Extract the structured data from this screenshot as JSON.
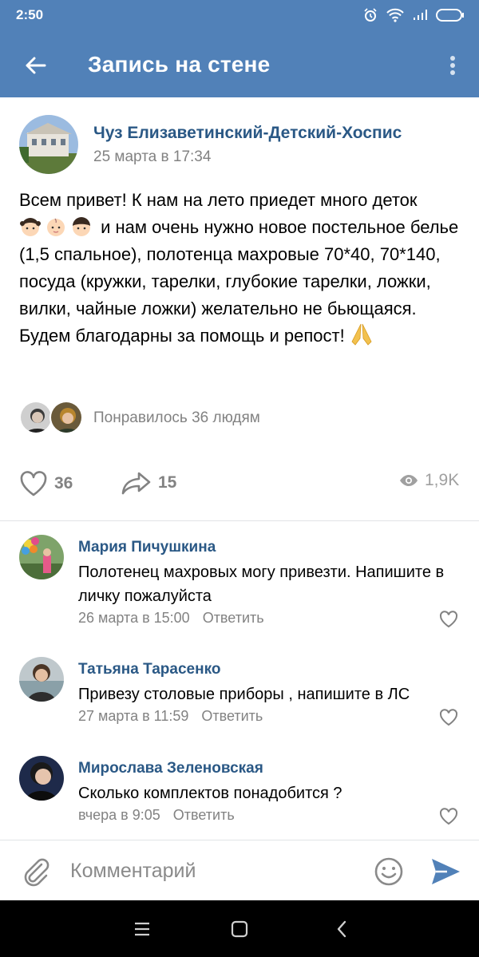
{
  "status": {
    "time": "2:50"
  },
  "header": {
    "title": "Запись на стене",
    "back_icon": "arrow-left-icon",
    "menu_icon": "more-vertical-icon"
  },
  "colors": {
    "header": "#5181b8",
    "link": "#2a5885",
    "muted": "#828282",
    "send": "#5181b8"
  },
  "post": {
    "author": "Чуз Елизаветинский-Детский-Хоспис",
    "date": "25 марта в 17:34",
    "text": {
      "line1": "Всем привет! К нам на лето приедет много деток",
      "line2": "и нам очень нужно новое постельное белье (1,5 спальное), полотенца махровые 70*40, 70*140, посуда (кружки, тарелки, глубокие тарелки, ложки, вилки, чайные ложки) желательно не бьющаяся.",
      "line3": "Будем благодарны за помощь и репост!"
    },
    "likes_text": "Понравилось 36 людям",
    "like_count": "36",
    "share_count": "15",
    "views": "1,9K"
  },
  "comments": [
    {
      "author": "Мария Пичушкина",
      "text": "Полотенец махровых могу привезти. Напишите в личку пожалуйста",
      "date": "26 марта в 15:00",
      "reply": "Ответить"
    },
    {
      "author": "Татьяна Тарасенко",
      "text": "Привезу столовые приборы , напишите в ЛС",
      "date": "27 марта в 11:59",
      "reply": "Ответить"
    },
    {
      "author": "Мирослава Зеленовская",
      "text": "Сколько комплектов понадобится ?",
      "date": "вчера в 9:05",
      "reply": "Ответить"
    }
  ],
  "input": {
    "placeholder": "Комментарий"
  }
}
